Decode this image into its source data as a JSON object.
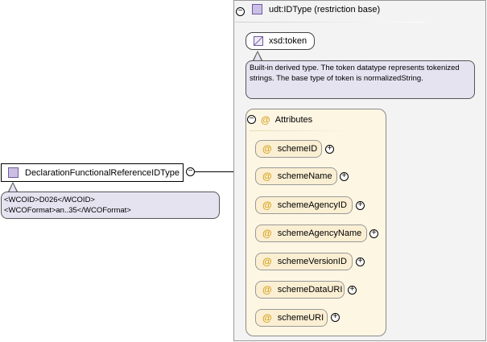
{
  "root": {
    "label": "DeclarationFunctionalReferenceIDType",
    "doc_lines": [
      "<WCOID>D026</WCOID>",
      "<WCOFormat>an..35</WCOFormat>"
    ]
  },
  "restriction": {
    "label": "udt:IDType (restriction base)",
    "base_type": "xsd:token",
    "base_doc": "Built-in derived type. The token datatype represents tokenized strings. The base type of token is normalizedString."
  },
  "attributes": {
    "header": "Attributes",
    "items": [
      {
        "label": "schemeID"
      },
      {
        "label": "schemeName"
      },
      {
        "label": "schemeAgencyID"
      },
      {
        "label": "schemeAgencyName"
      },
      {
        "label": "schemeVersionID"
      },
      {
        "label": "schemeDataURI"
      },
      {
        "label": "schemeURI"
      }
    ]
  },
  "symbols": {
    "collapse": "−",
    "expand": "+",
    "attribute": "@"
  },
  "colors": {
    "type_icon_fill": "#cbbfe6",
    "doc_bubble": "#e6e3f1",
    "attribute_fill": "#fbefd3",
    "group_fill": "#fdf6e3",
    "attribute_symbol": "#d7a21a"
  }
}
